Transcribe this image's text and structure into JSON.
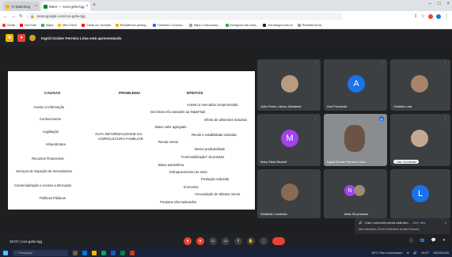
{
  "browser": {
    "tabs": [
      {
        "title": "Yt Watching"
      },
      {
        "title": "Meet — cxxx-gxfw-tqg"
      }
    ],
    "url": "meet.google.com/cxx-gxfw-tqg",
    "bookmarks": [
      "Gmail",
      "YouTube",
      "Maps",
      "Meu Drive",
      "Canal do Youtube",
      "Residência pedag...",
      "Trabalho Conclus...",
      "https://.educacao...",
      "Instagram dei aula...",
      "Jornalégua.edu.br",
      "Residência Bl..."
    ]
  },
  "meeting": {
    "presenter_label": "Ingrid Gruber Ferreira Lima está apresentando",
    "code": "10:07 | cxx-gxfw-tqg",
    "participants": [
      {
        "name": "João Pedro Llanos Zebaletra",
        "avatar": "photo"
      },
      {
        "name": "Ana Fernanda",
        "avatar": "letter",
        "letter": "A",
        "color": "#1a73e8"
      },
      {
        "name": "Crisitala Leal",
        "avatar": "photo"
      },
      {
        "name": "Mary Stela Bischof",
        "avatar": "letter",
        "letter": "M",
        "color": "#a142f4"
      },
      {
        "name": "Ingrid Gruber Ferreira Lima",
        "avatar": "photo"
      },
      {
        "name": "Cam Sontesas",
        "avatar": "photo"
      },
      {
        "name": "Walderlin Lucinhas",
        "avatar": "photo"
      },
      {
        "name": "Mais 35 pessoas",
        "avatar": "group",
        "letter": "N"
      },
      {
        "name": "",
        "avatar": "letter",
        "letter": "L",
        "color": "#1a73e8"
      }
    ],
    "toast": {
      "title": "Cam Lorenzo/Lucena está ativ...",
      "action": "Abrir aba",
      "subtitle": "Alto-falantes (Tecfí Definition Audio Device)"
    }
  },
  "slide": {
    "headers": {
      "causas": "CAUSAS",
      "problema": "PROBLEMA",
      "efeitos": "EFEITOS"
    },
    "problema": [
      "ALTA INFORMALIDADE DA",
      "AGRICULTURA FAMILIAR"
    ],
    "causas": [
      "Acesso à informação",
      "Conhecimento",
      "Legislação",
      "Infraestrutura",
      "Recursos Financeiros",
      "Serviços de inspeção de mercados/as",
      "Comercialização e Acesso a Mercados",
      "Políticas Públicas"
    ],
    "efeitos": [
      "Acesso a mercados comprometida",
      "Dec/níveo rêo atendem ao IN&SFI&E",
      "Oferta de alimentos reduzida",
      "Baixo valor agregado",
      "Rendo e estabilidade reduzida",
      "Renda menor",
      "Menor produtividade",
      "\"Commoditização\" do produto",
      "Baixa autoestima",
      "Enfraquecimento do setor",
      "Produção reduzida",
      "Economia",
      "Arrecadação de tributos menor",
      "Produtos não-rastreados"
    ]
  },
  "taskbar": {
    "search_placeholder": "Pesquisar",
    "weather": "30°C  Parc ensolarado",
    "time": "10:07",
    "date": "19/03/2025"
  }
}
